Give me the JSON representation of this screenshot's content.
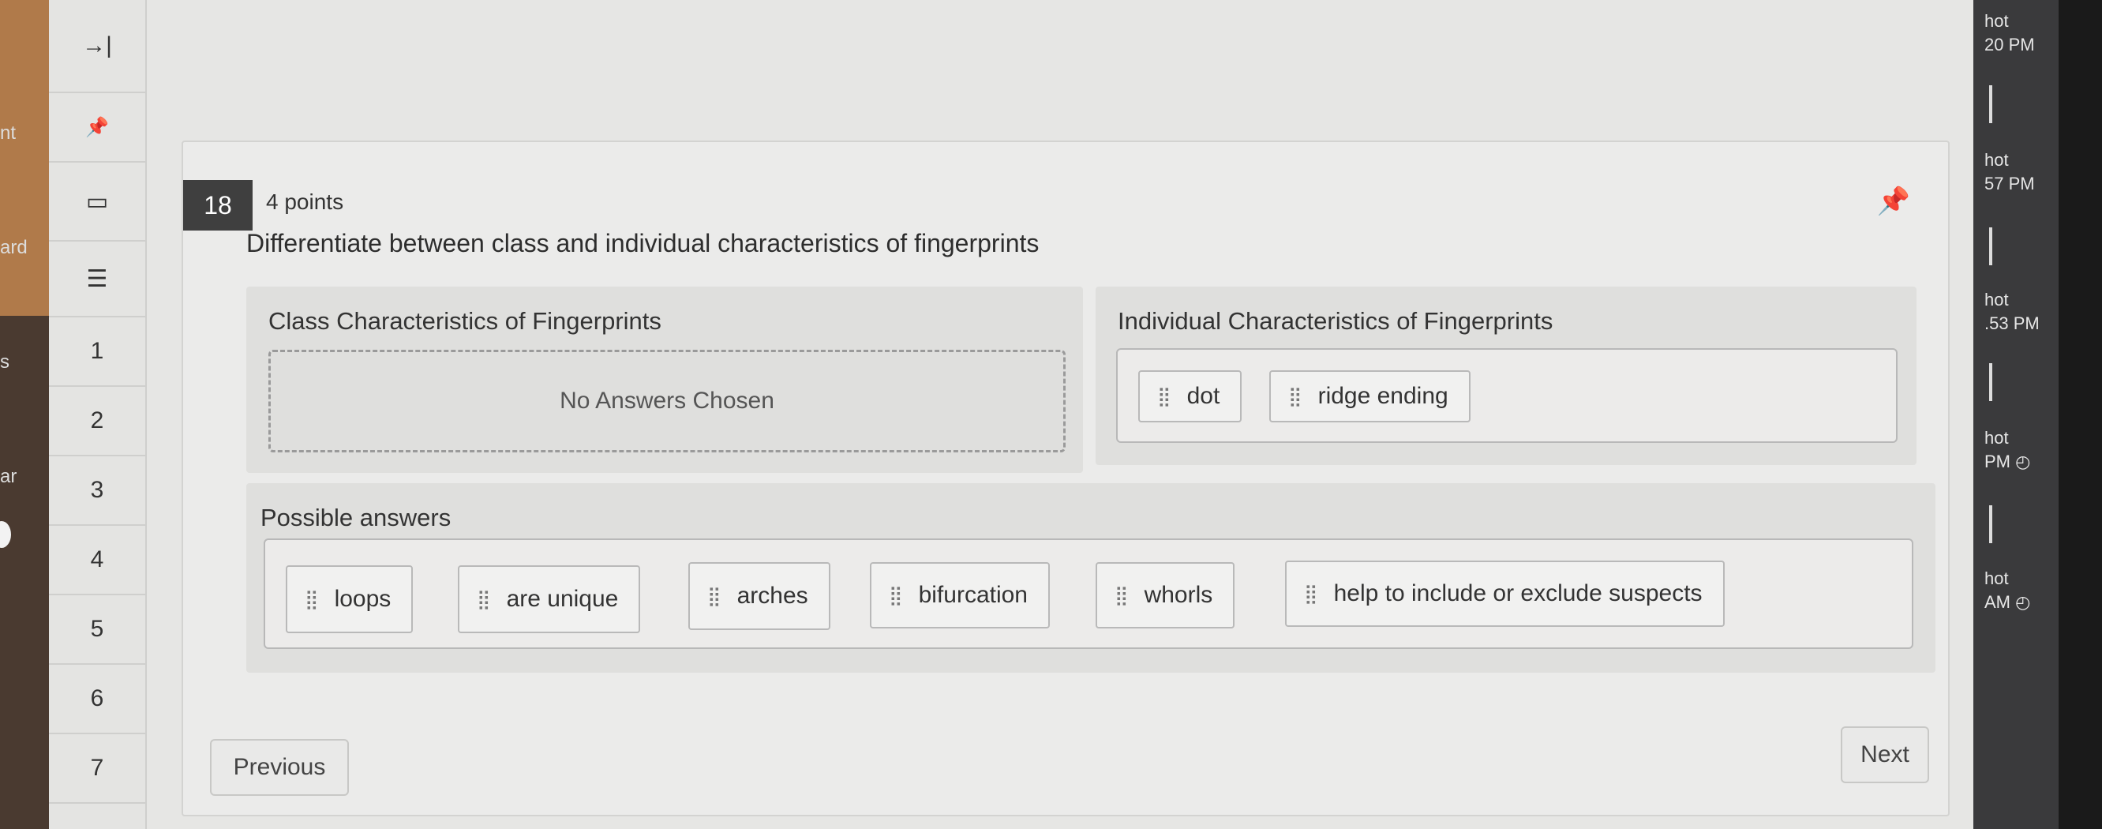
{
  "background_left": {
    "fragments": [
      "nt",
      "ard",
      "s",
      "ar"
    ]
  },
  "nav": {
    "items": [
      {
        "name": "collapse-icon",
        "label": "→|"
      },
      {
        "name": "pin-icon",
        "label": "📌"
      },
      {
        "name": "bookmark-icon",
        "label": "▭"
      },
      {
        "name": "notes-icon",
        "label": "☰"
      },
      {
        "name": "question-1",
        "label": "1"
      },
      {
        "name": "question-2",
        "label": "2"
      },
      {
        "name": "question-3",
        "label": "3"
      },
      {
        "name": "question-4",
        "label": "4"
      },
      {
        "name": "question-5",
        "label": "5"
      },
      {
        "name": "question-6",
        "label": "6"
      },
      {
        "name": "question-7",
        "label": "7"
      }
    ]
  },
  "rightbar": {
    "entries": [
      {
        "line1": "hot",
        "line2": "20 PM"
      },
      {
        "line1": "hot",
        "line2": "57 PM"
      },
      {
        "line1": "hot",
        "line2": ".53 PM"
      },
      {
        "line1": "hot",
        "line2": "PM ◴"
      },
      {
        "line1": "hot",
        "line2": "AM ◴"
      }
    ]
  },
  "question": {
    "number": "18",
    "points": "4 points",
    "prompt": "Differentiate between class and individual characteristics of fingerprints",
    "pin_icon": "📌"
  },
  "categories": {
    "class_title": "Class Characteristics of Fingerprints",
    "class_empty": "No Answers Chosen",
    "individual_title": "Individual Characteristics of Fingerprints",
    "individual_items": [
      "dot",
      "ridge ending"
    ]
  },
  "possible": {
    "title": "Possible answers",
    "items": [
      "loops",
      "are unique",
      "arches",
      "bifurcation",
      "whorls",
      "help to include or exclude suspects"
    ]
  },
  "grip_icon": "⣿",
  "buttons": {
    "previous": "Previous",
    "next": "Next"
  }
}
